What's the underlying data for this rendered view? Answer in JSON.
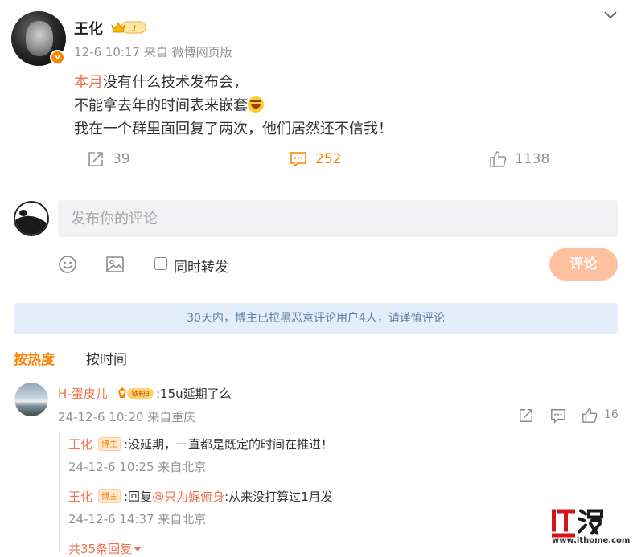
{
  "post": {
    "username": "王化",
    "vip_level": "1",
    "meta": "12-6 10:17  来自 微博网页版",
    "text": {
      "line1_highlight": "本月",
      "line1_rest": "没有什么技术发布会，",
      "line2": "不能拿去年的时间表来嵌套",
      "line3": "我在一个群里面回复了两次，他们居然还不信我！"
    },
    "reposts": "39",
    "comments": "252",
    "likes": "1138"
  },
  "composer": {
    "placeholder": "发布你的评论",
    "checkbox_label": "同时转发",
    "submit_label": "评论"
  },
  "notice": "30天内，博主已拉黑恶意评论用户4人，请谨慎评论",
  "sort": {
    "hot": "按热度",
    "time": "按时间"
  },
  "comment": {
    "username": "H-蛋皮儿",
    "fan_badge": "铁粉3",
    "text": ":15u延期了么",
    "meta": "24-12-6 10:20  来自重庆",
    "likes": "16",
    "replies": [
      {
        "username": "王化",
        "badge": "博主",
        "text": ":没延期，一直都是既定的时间在推进！",
        "meta": "24-12-6 10:25  来自北京"
      },
      {
        "username": "王化",
        "badge": "博主",
        "text_prefix": ":回复",
        "mention": "@只为娓俯身",
        "text_suffix": ":从来没打算过1月发",
        "meta": "24-12-6 14:37  来自北京"
      }
    ],
    "more_replies": "共35条回复"
  },
  "watermark": {
    "logo": "IT之家",
    "url": "www.ithome.com"
  },
  "colors": {
    "accent": "#ff8200",
    "link": "#eb7350",
    "muted": "#939393",
    "notice_bg": "#e3eefa",
    "button_disabled": "#ffc09f"
  }
}
